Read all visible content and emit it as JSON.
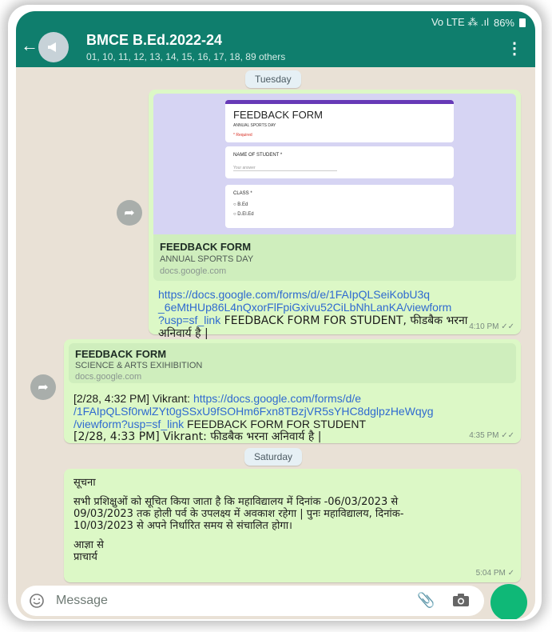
{
  "status_bar": {
    "signal": "Vo LTE ⁂ .ıl",
    "battery": "86%"
  },
  "header": {
    "title": "BMCE B.Ed.2022-24",
    "subtitle": "01, 10, 11, 12, 13, 14, 15, 16, 17, 18, 89 others"
  },
  "messages": [
    {
      "day": "Tuesday",
      "form": {
        "heading": "FEEDBACK FORM",
        "subheading": "ANNUAL SPORTS DAY",
        "required": "* Required",
        "q1": "NAME OF STUDENT *",
        "q1_placeholder": "Your answer",
        "q2": "CLASS *",
        "opt1": "B.Ed",
        "opt2": "D.El.Ed"
      },
      "preview": {
        "title": "FEEDBACK FORM",
        "subtitle": "ANNUAL SPORTS DAY",
        "domain": "docs.google.com"
      },
      "link": "https://docs.google.com/forms/d/e/1FAIpQLSeiKobU3q_6eMtHUp86L4nQxorFlFpiGxivu52CiLbNhLanKA/viewform?usp=sf_link",
      "link_lines": [
        "https://docs.google.com/forms/d/e/1FAIpQLSeiKobU3q",
        "_6eMtHUp86L4nQxorFlFpiGxivu52CiLbNhLanKA/viewform",
        "?usp=sf_link"
      ],
      "text_after_link": " FEEDBACK FORM FOR STUDENT, फीडबैक भरना",
      "text_line2": "अनिवार्य है |",
      "time": "4:10 PM ✓✓"
    },
    {
      "preview": {
        "title": "FEEDBACK FORM",
        "subtitle": "SCIENCE & ARTS EXIHIBITION",
        "domain": "docs.google.com"
      },
      "line1_prefix": "[2/28, 4:32 PM] Vikrant: ",
      "link_lines": [
        "https://docs.google.com/forms/d/e",
        "/1FAIpQLSf0rwlZYt0gSSxU9fSOHm6Fxn8TBzjVR5sYHC8dglpzHeWqyg",
        "/viewform?usp=sf_link"
      ],
      "line3_suffix": " FEEDBACK FORM FOR STUDENT",
      "line4": "[2/28, 4:33 PM] Vikrant: फीडबैक भरना  अनिवार्य है |",
      "time": "4:35 PM ✓✓"
    },
    {
      "day": "Saturday",
      "lines": [
        "सूचना",
        "",
        "सभी प्रशिक्षुओं को सूचित किया जाता है कि महाविद्यालय में दिनांक -06/03/2023 से",
        "09/03/2023 तक होली पर्व के उपलक्ष्य में अवकाश रहेगा | पुनः महाविद्यालय, दिनांक-",
        "10/03/2023 से अपने निर्धारित समय से संचालित होगा।",
        "",
        "आज्ञा से",
        "प्राचार्य"
      ],
      "time": "5:04 PM ✓"
    }
  ],
  "composer": {
    "placeholder": "Message"
  },
  "colors": {
    "header": "#0f7e6d",
    "bubble": "#dcf8c6",
    "link": "#2f6ad0",
    "send": "#0fb877"
  }
}
